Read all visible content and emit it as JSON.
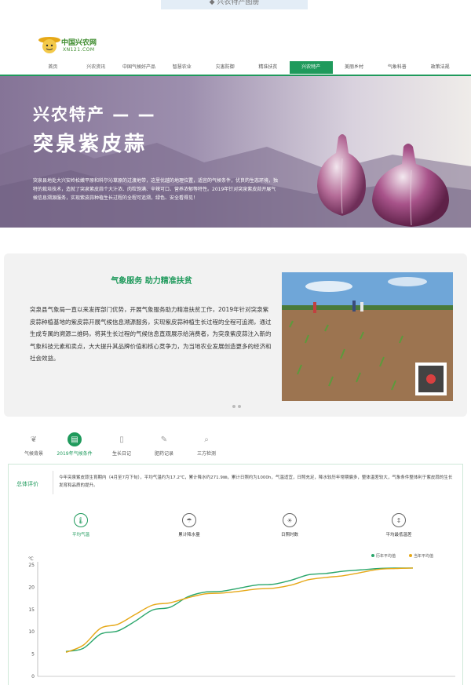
{
  "caption": "◆ 兴农特产图册",
  "logo": {
    "name": "中国兴农网",
    "domain": "XN121.COM"
  },
  "nav": [
    "首页",
    "兴农资讯",
    "中国气候好产品",
    "智慧农业",
    "灾害防御",
    "精准扶贫",
    "兴农特产",
    "美丽乡村",
    "气象科普",
    "政策法规"
  ],
  "nav_active_index": 6,
  "hero": {
    "title": "兴农特产 — —",
    "subtitle": "突泉紫皮蒜",
    "description": "突泉县地处大兴安岭松嫩平原和科尔沁草原的过渡地带，这里优越的地理位置，适宜的气候条件，优良的生态环境，独特的栽培技术，造就了突泉紫皮蒜个大汁浓、肉粒饱满、辛辣可口、营养浓郁等特性。2019年针对突泉紫皮蒜开展气候信息溯源服务，实现紫皮蒜种植生长过程的全程可追溯，绿色、安全看得见！"
  },
  "card": {
    "title": "气象服务 助力精准扶贫",
    "text": "突泉县气象局一直以来发挥部门优势，开展气象服务助力精准扶贫工作，2019年针对突泉紫皮蒜种植基地的紫皮蒜开展气候信息溯源服务，实现紫皮蒜种植生长过程的全程可追溯，通过生成专属的溯源二维码，将其生长过程的气候信息直观展示给消费者，为突泉紫皮蒜注入新的气象科技元素和卖点，大大提升其品牌价值和核心竞争力，为当地农业发展创造更多的经济和社会效益。"
  },
  "tabs": [
    {
      "label": "气候背景",
      "icon": "leaf-icon"
    },
    {
      "label": "2019年气候条件",
      "icon": "calendar-chart-icon",
      "active": true
    },
    {
      "label": "生长日记",
      "icon": "diary-icon"
    },
    {
      "label": "肥药记录",
      "icon": "fertilizer-icon"
    },
    {
      "label": "三方检测",
      "icon": "magnifier-icon"
    }
  ],
  "evaluation": {
    "label": "总体评价",
    "text": "今年突泉紫皮蒜生育期内（4月至7月下旬），平均气温约为17.2℃，累计降水约271.9㎜，累计日照约为1000h，气温适宜，日照充足，降水较历年常期偏多，整体温差较大，气象条件整体利于紫皮蒜的生长发育和品质的提升。"
  },
  "metrics": [
    {
      "label": "平均气温",
      "icon": "thermometer-icon",
      "active": true
    },
    {
      "label": "累计降水量",
      "icon": "rain-cloud-icon"
    },
    {
      "label": "日照时数",
      "icon": "sun-icon"
    },
    {
      "label": "平均最低温差",
      "icon": "temperature-range-icon"
    }
  ],
  "chart_data": {
    "type": "line",
    "ylabel": "℃",
    "ylim": [
      0,
      25
    ],
    "yticks": [
      0,
      5,
      10,
      15,
      20,
      25
    ],
    "x": [
      0,
      1,
      2,
      3,
      4,
      5,
      6,
      7,
      8,
      9,
      10,
      11,
      12,
      13,
      14,
      15,
      16,
      17,
      18,
      19,
      20
    ],
    "series": [
      {
        "name": "历年平均值",
        "color": "#2aa66b",
        "values": [
          5.6,
          6.3,
          9.5,
          10.2,
          12.4,
          14.9,
          15.5,
          17.8,
          18.9,
          19.1,
          19.8,
          20.5,
          20.7,
          21.6,
          22.8,
          23.1,
          23.6,
          23.9,
          24.2,
          24.3,
          24.3
        ]
      },
      {
        "name": "当年平均值",
        "color": "#e6a817",
        "values": [
          5.4,
          7.0,
          10.8,
          11.7,
          13.9,
          16.0,
          16.5,
          17.6,
          18.5,
          18.7,
          19.1,
          19.6,
          19.8,
          20.5,
          21.7,
          22.2,
          22.6,
          23.3,
          24.0,
          24.2,
          24.3
        ]
      }
    ],
    "legend_position": "top-right",
    "grid": false
  }
}
